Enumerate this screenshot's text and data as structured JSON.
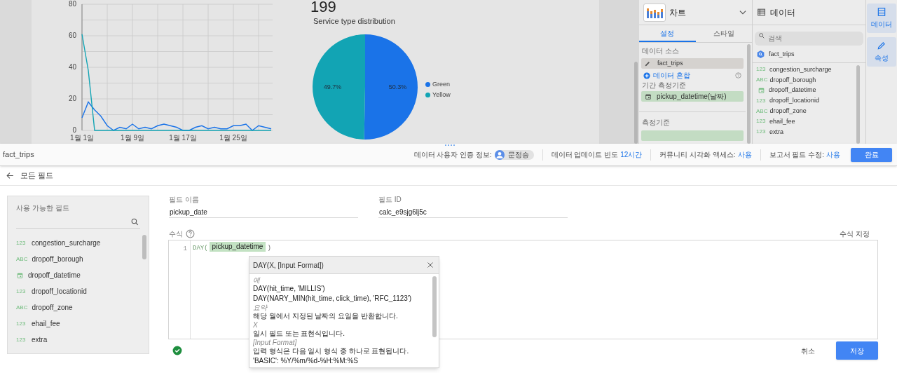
{
  "canvas": {
    "scorecard": {
      "value": "199"
    },
    "line_chart": {
      "chart_data": {
        "type": "line",
        "categories": [
          "1월 1일",
          null,
          null,
          null,
          null,
          null,
          null,
          null,
          "1월 9일",
          null,
          null,
          null,
          null,
          null,
          null,
          null,
          "1월 17일",
          null,
          null,
          null,
          null,
          null,
          null,
          null,
          "1월 25일",
          null,
          null,
          null,
          null,
          null,
          null
        ],
        "ylim": [
          0,
          80
        ],
        "yticks": [
          0,
          20,
          40,
          60,
          80
        ],
        "grid": true,
        "series": [
          {
            "color": "#1a73e8",
            "values": [
              8,
              18,
              13,
              9,
              3,
              0,
              2,
              1,
              4,
              1,
              2,
              1,
              3,
              4,
              3,
              2,
              0,
              0,
              2,
              3,
              1,
              2,
              1,
              1,
              3,
              3,
              4,
              0,
              3,
              2,
              1
            ]
          },
          {
            "color": "#12a4b4",
            "values": [
              61,
              38,
              0,
              0,
              0,
              0,
              0,
              0,
              0,
              0,
              0,
              0,
              0,
              0,
              0,
              0,
              0,
              0,
              0,
              0,
              0,
              0,
              0,
              0,
              0,
              0,
              0,
              0,
              0,
              0,
              0
            ]
          }
        ]
      }
    },
    "pie_chart": {
      "chart_data": {
        "type": "pie",
        "title": "Service type distribution",
        "categories": [
          "Green",
          "Yellow"
        ],
        "values": [
          50.3,
          49.7
        ],
        "value_labels": [
          "50.3%",
          "49.7%"
        ],
        "colors": [
          "#1a73e8",
          "#12a4b4"
        ],
        "legend": true
      }
    }
  },
  "chart_panel": {
    "title": "차트",
    "tabs": [
      {
        "label": "설정",
        "selected": true
      },
      {
        "label": "스타일",
        "selected": false
      }
    ],
    "data_source_label": "데이터 소스",
    "data_source": "fact_trips",
    "blend_link": "데이터 혼합",
    "date_range_label": "기간 측정기준",
    "date_range_field": "pickup_datetime(날짜)",
    "dimension_label": "측정기준"
  },
  "data_panel": {
    "title": "데이터",
    "search": {
      "placeholder": "검색"
    },
    "source": "fact_trips",
    "fields": [
      {
        "kind": "number",
        "badge": "123",
        "name": "congestion_surcharge"
      },
      {
        "kind": "text",
        "badge": "ABC",
        "name": "dropoff_borough"
      },
      {
        "kind": "date",
        "name": "dropoff_datetime"
      },
      {
        "kind": "number",
        "badge": "123",
        "name": "dropoff_locationid"
      },
      {
        "kind": "text",
        "badge": "ABC",
        "name": "dropoff_zone"
      },
      {
        "kind": "number",
        "badge": "123",
        "name": "ehail_fee"
      },
      {
        "kind": "number",
        "badge": "123",
        "name": "extra"
      }
    ]
  },
  "side_rail": [
    {
      "label": "데이터"
    },
    {
      "label": "속성"
    }
  ],
  "editor_header": {
    "source": "fact_trips",
    "credentials_label": "데이터 사용자 인증 정보:",
    "credentials_user": "문정승",
    "freshness_label": "데이터 업데이트 빈도",
    "freshness_value": "12시간",
    "community_label": "커뮤니티 시각화 액세스:",
    "community_value": "사용",
    "field_edit_label": "보고서 필드 수정:",
    "field_edit_value": "사용",
    "done_button": "완료"
  },
  "back_link": "모든 필드",
  "available_fields": {
    "title": "사용 가능한 필드",
    "fields": [
      {
        "kind": "number",
        "badge": "123",
        "name": "congestion_surcharge"
      },
      {
        "kind": "text",
        "badge": "ABC",
        "name": "dropoff_borough"
      },
      {
        "kind": "date",
        "name": "dropoff_datetime"
      },
      {
        "kind": "number",
        "badge": "123",
        "name": "dropoff_locationid"
      },
      {
        "kind": "text",
        "badge": "ABC",
        "name": "dropoff_zone"
      },
      {
        "kind": "number",
        "badge": "123",
        "name": "ehail_fee"
      },
      {
        "kind": "number",
        "badge": "123",
        "name": "extra"
      }
    ]
  },
  "field_name": {
    "label": "필드 이름",
    "value": "pickup_date"
  },
  "field_id": {
    "label": "필드 ID",
    "value": "calc_e9sjg6lj5c"
  },
  "formula": {
    "label": "수식",
    "format_link": "수식 지정",
    "line_number": "1",
    "function": "DAY(",
    "field": "pickup_datetime",
    "close": ")",
    "valid": true
  },
  "help_popup": {
    "title": "DAY(X, [Input Format])",
    "sections": [
      {
        "heading": "예",
        "lines": [
          "DAY(hit_time, 'MILLIS')",
          "DAY(NARY_MIN(hit_time, click_time), 'RFC_1123')"
        ]
      },
      {
        "heading": "요약",
        "lines": [
          "해당 월에서 지정된 날짜의 요일을 반환합니다."
        ]
      },
      {
        "heading": "X",
        "lines": [
          "일시 필드 또는 표현식입니다."
        ]
      },
      {
        "heading": "[Input Format]",
        "lines": [
          "입력 형식은 다음 일시 형식 중 하나로 표현됩니다.",
          "'BASIC': %Y/%m/%d-%H:%M:%S"
        ]
      }
    ]
  },
  "cancel_button": "취소",
  "save_button": "저장"
}
